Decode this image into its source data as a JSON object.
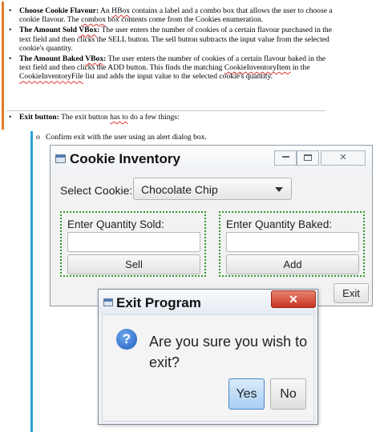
{
  "document": {
    "items": [
      {
        "title": "Choose Cookie Flavour:",
        "text_a": " An ",
        "squiggle_a": "HBox",
        "text_b": " contains a label and a combo box that allows the user to choose a cookie flavour. The ",
        "squiggle_b": "combox",
        "text_c": " box contents come from the Cookies enumeration."
      },
      {
        "title_a": "The Amount Sold ",
        "title_squiggle": "VBox",
        "title_b": ":",
        "text": " The user enters the number of cookies of a certain flavour purchased in the text field and then clicks the SELL button. The sell button subtracts the input value from the selected cookie's quantity."
      },
      {
        "title_a": "The Amount Baked ",
        "title_squiggle": "VBox",
        "title_b": ":",
        "text_a": " The user enters the number of cookies of a certain flavour baked in the text field and then clicks the ADD button. This finds the matching ",
        "squiggle_a": "CookieInventoryItem",
        "text_b": " in the ",
        "squiggle_b": "CookieInventoryFile",
        "text_c": " list and adds the input value to the selected cookie's quantity."
      }
    ],
    "exit_item": {
      "title": "Exit button:",
      "text_a": " The exit button ",
      "squiggle": "has to",
      "text_b": " do a few things:"
    },
    "sub_item": {
      "bullet": "o",
      "text": "Confirm exit with the user using an alert dialog box."
    },
    "bullet_glyph": "•"
  },
  "main_window": {
    "title": "Cookie Inventory",
    "close_glyph": "✕",
    "select_label": "Select Cookie:",
    "selected_cookie": "Chocolate Chip",
    "sold_label": "Enter Quantity Sold:",
    "sold_value": "",
    "sell_button": "Sell",
    "baked_label": "Enter Quantity Baked:",
    "baked_value": "",
    "add_button": "Add",
    "exit_button": "Exit"
  },
  "dialog": {
    "title": "Exit Program",
    "close_glyph": "✕",
    "icon_glyph": "?",
    "message": "Are you sure you wish to exit?",
    "yes_button": "Yes",
    "no_button": "No"
  },
  "colors": {
    "orange_rule": "#e07a2c",
    "blue_rule": "#2aa3d9",
    "vbox_border": "#2f9a2f",
    "close_red": "#c73520",
    "default_button_blue": "#a9cef2"
  }
}
